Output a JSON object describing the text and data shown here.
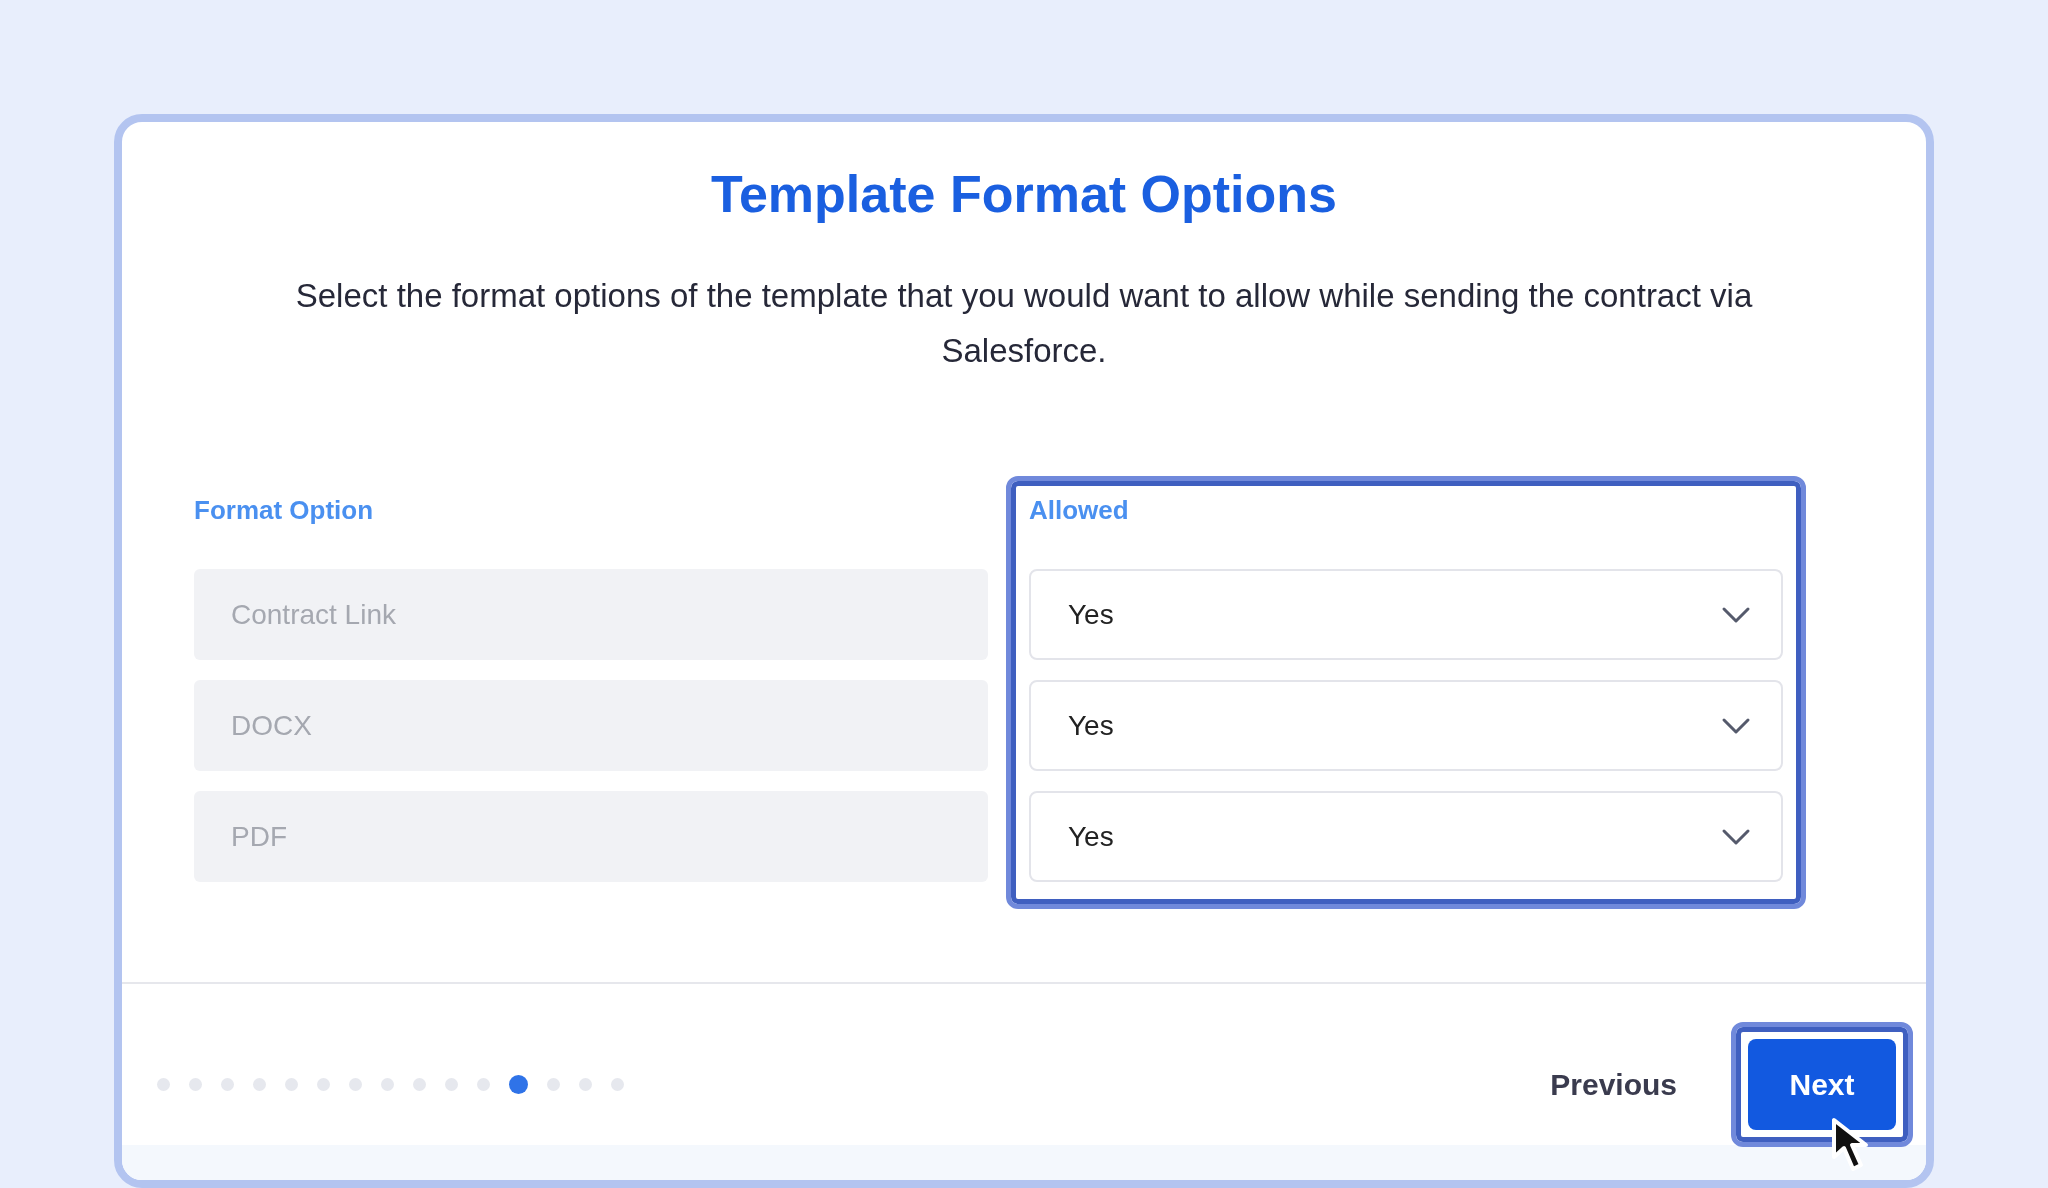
{
  "title": "Template Format Options",
  "description": "Select the format options of the template that you would want to allow while sending the contract via Salesforce.",
  "columns": {
    "option": "Format Option",
    "allowed": "Allowed"
  },
  "rows": [
    {
      "option": "Contract Link",
      "disabled": true,
      "allowed": "Yes"
    },
    {
      "option": "DOCX",
      "disabled": true,
      "allowed": "Yes"
    },
    {
      "option": "PDF",
      "disabled": true,
      "allowed": "Yes"
    }
  ],
  "steps": [
    {
      "selected": false
    },
    {
      "selected": false
    },
    {
      "selected": false
    },
    {
      "selected": false
    },
    {
      "selected": false
    },
    {
      "selected": false
    },
    {
      "selected": false
    },
    {
      "selected": false
    },
    {
      "selected": false
    },
    {
      "selected": false
    },
    {
      "selected": false
    },
    {
      "selected": true
    },
    {
      "selected": false
    },
    {
      "selected": false
    },
    {
      "selected": false
    }
  ],
  "buttons": {
    "previous": "Previous",
    "next": "Next"
  }
}
